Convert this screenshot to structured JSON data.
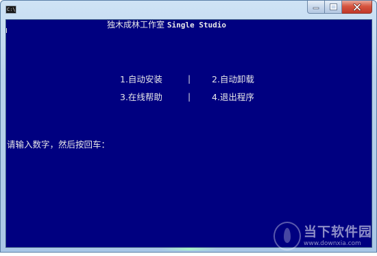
{
  "window": {
    "icon_text": "C:\\",
    "colors": {
      "console_bg": "#000080",
      "console_text": "#e8e8e8",
      "close_button": "#c9463a"
    }
  },
  "console": {
    "title_cn": "独木成林工作室",
    "title_en": "Single Studio",
    "menu": [
      {
        "label": "1.自动安装"
      },
      {
        "label": "2.自动卸载"
      },
      {
        "label": "3.在线帮助"
      },
      {
        "label": "4.退出程序"
      }
    ],
    "separator": "|",
    "prompt": "请输入数字，然后按回车："
  },
  "watermark": {
    "name": "当下软件园",
    "url": "www.downxia.com"
  }
}
